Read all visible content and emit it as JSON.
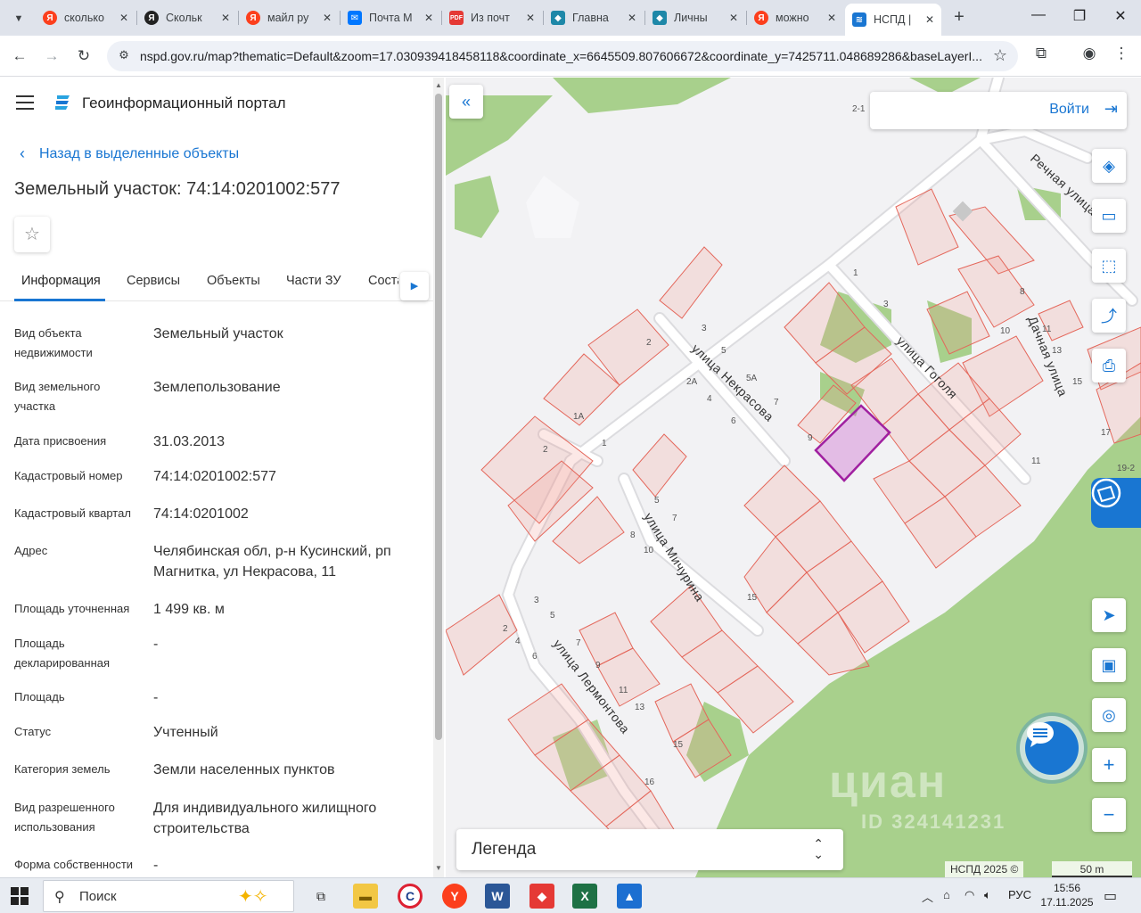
{
  "browser": {
    "tabs": [
      {
        "label": "сколько",
        "icon": "yandex-icon",
        "color": "#fc3f1d"
      },
      {
        "label": "Скольк",
        "icon": "yandex-icon",
        "color": "#222222"
      },
      {
        "label": "майл ру",
        "icon": "yandex-icon",
        "color": "#fc3f1d"
      },
      {
        "label": "Почта М",
        "icon": "mail-icon",
        "color": "#0077ff"
      },
      {
        "label": "Из почт",
        "icon": "pdf-icon",
        "color": "#e53935"
      },
      {
        "label": "Главна",
        "icon": "gosuslugi-icon",
        "color": "#1e88a8"
      },
      {
        "label": "Личны",
        "icon": "gosuslugi-icon",
        "color": "#1e88a8"
      },
      {
        "label": "можно",
        "icon": "yandex-icon",
        "color": "#fc3f1d"
      },
      {
        "label": "НСПД |",
        "icon": "nspd-icon",
        "color": "#1976d2",
        "active": true
      }
    ],
    "url": "nspd.gov.ru/map?thematic=Default&zoom=17.030939418458118&coordinate_x=6645509.807606672&coordinate_y=7425711.048689286&baseLayerI..."
  },
  "panel": {
    "portal_title": "Геоинформационный портал",
    "back_label": "Назад в выделенные объекты",
    "object_title": "Земельный участок: 74:14:0201002:577",
    "tabs": [
      "Информация",
      "Сервисы",
      "Объекты",
      "Части ЗУ",
      "Соста"
    ],
    "properties": [
      {
        "label": "Вид объекта недвижимости",
        "value": "Земельный участок"
      },
      {
        "label": "Вид земельного участка",
        "value": "Землепользование"
      },
      {
        "label": "Дата присвоения",
        "value": "31.03.2013"
      },
      {
        "label": "Кадастровый номер",
        "value": "74:14:0201002:577"
      },
      {
        "label": "Кадастровый квартал",
        "value": "74:14:0201002"
      },
      {
        "label": "Адрес",
        "value": "Челябинская обл, р-н Кусинский, рп Магнитка, ул Некрасова, 11"
      },
      {
        "label": "Площадь уточненная",
        "value": "1 499 кв. м"
      },
      {
        "label": "Площадь декларированная",
        "value": "-"
      },
      {
        "label": "Площадь",
        "value": "-"
      },
      {
        "label": "Статус",
        "value": "Учтенный"
      },
      {
        "label": "Категория земель",
        "value": "Земли населенных пунктов"
      },
      {
        "label": "Вид разрешенного использования",
        "value": "Для индивидуального жилищного строительства"
      },
      {
        "label": "Форма собственности",
        "value": "-"
      }
    ]
  },
  "map": {
    "login_label": "Войти",
    "legend_label": "Легенда",
    "attribution": "НСПД 2025 ©",
    "scale_label": "50 m",
    "watermark": "циан",
    "watermark_id": "ID 324141231",
    "streets": {
      "nekrasova": "улица Некрасова",
      "gogolya": "улица Гоголя",
      "michurina": "улица Мичурина",
      "lermontova": "улица Лермонтова",
      "dachnaya": "Дачная улица",
      "rechnaya": "Речная улица"
    },
    "numbers": [
      "2-1",
      "1",
      "3",
      "8",
      "10",
      "11",
      "13",
      "15",
      "17",
      "19-2",
      "3",
      "5",
      "2",
      "2А",
      "4",
      "5А",
      "7",
      "6",
      "9",
      "1А",
      "2",
      "1",
      "11",
      "5",
      "7",
      "8",
      "10",
      "15",
      "3",
      "5",
      "2",
      "4",
      "6",
      "7",
      "9",
      "11",
      "13",
      "15",
      "16"
    ]
  },
  "taskbar": {
    "search_label": "Поиск",
    "lang": "РУС",
    "time": "15:56",
    "date": "17.11.2025"
  }
}
